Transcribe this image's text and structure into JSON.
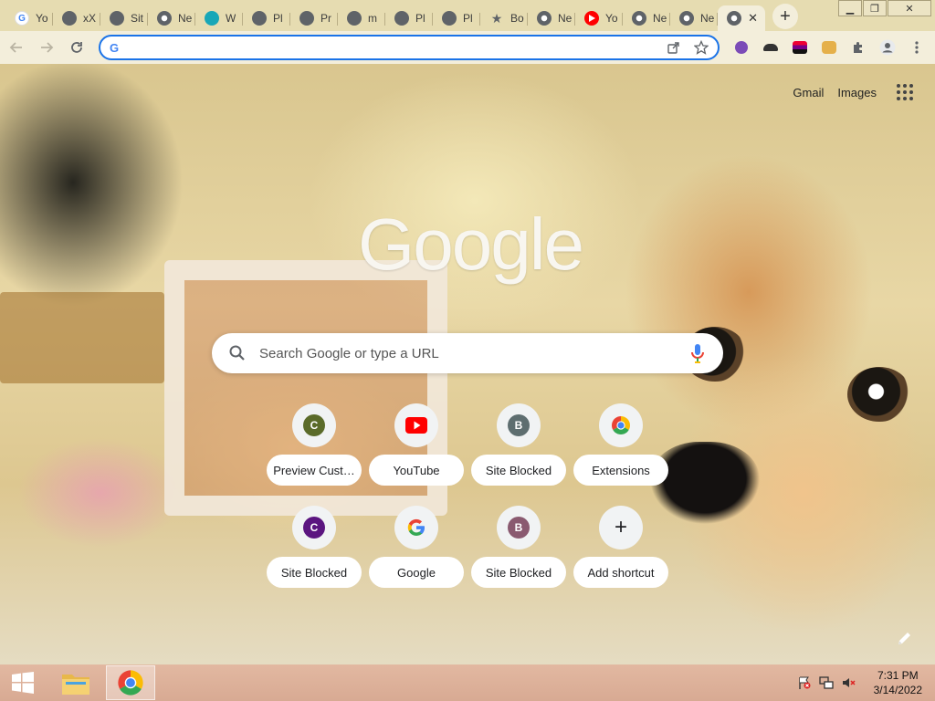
{
  "tabs": [
    {
      "label": "Yo",
      "icon": "google-g-icon"
    },
    {
      "label": "xX",
      "icon": "globe-icon"
    },
    {
      "label": "Sit",
      "icon": "globe-icon"
    },
    {
      "label": "Ne",
      "icon": "chrome-icon"
    },
    {
      "label": "W",
      "icon": "teal-site-icon"
    },
    {
      "label": "Pl",
      "icon": "globe-icon"
    },
    {
      "label": "Pr",
      "icon": "globe-icon"
    },
    {
      "label": "m",
      "icon": "globe-icon"
    },
    {
      "label": "Pl",
      "icon": "globe-icon"
    },
    {
      "label": "Pl",
      "icon": "globe-icon"
    },
    {
      "label": "Bo",
      "icon": "star-icon"
    },
    {
      "label": "Ne",
      "icon": "chrome-icon"
    },
    {
      "label": "Yo",
      "icon": "youtube-icon"
    },
    {
      "label": "Ne",
      "icon": "chrome-icon"
    },
    {
      "label": "Ne",
      "icon": "chrome-icon"
    },
    {
      "label": "",
      "icon": "chrome-icon",
      "active": true
    }
  ],
  "omnibox": {
    "value": "",
    "placeholder": ""
  },
  "top_links": {
    "gmail": "Gmail",
    "images": "Images"
  },
  "logo_text": "Google",
  "search": {
    "placeholder": "Search Google or type a URL"
  },
  "shortcuts": [
    {
      "label": "Preview Cust…",
      "letter": "C",
      "color": "#5b6b2a"
    },
    {
      "label": "YouTube",
      "icon": "youtube-icon"
    },
    {
      "label": "Site Blocked",
      "letter": "B",
      "color": "#5e6e70"
    },
    {
      "label": "Extensions",
      "icon": "chrome-icon"
    },
    {
      "label": "Site Blocked",
      "letter": "C",
      "color": "#5b1580"
    },
    {
      "label": "Google",
      "icon": "google-g-icon"
    },
    {
      "label": "Site Blocked",
      "letter": "B",
      "color": "#8a5a70"
    },
    {
      "label": "Add shortcut",
      "icon": "plus-icon"
    }
  ],
  "taskbar": {
    "time": "7:31 PM",
    "date": "3/14/2022"
  },
  "colors": {
    "accent": "#1a73e8",
    "tab_strip": "#e6dcb1",
    "toolbar": "#f3eedb",
    "taskbar": "#d8aa93"
  }
}
